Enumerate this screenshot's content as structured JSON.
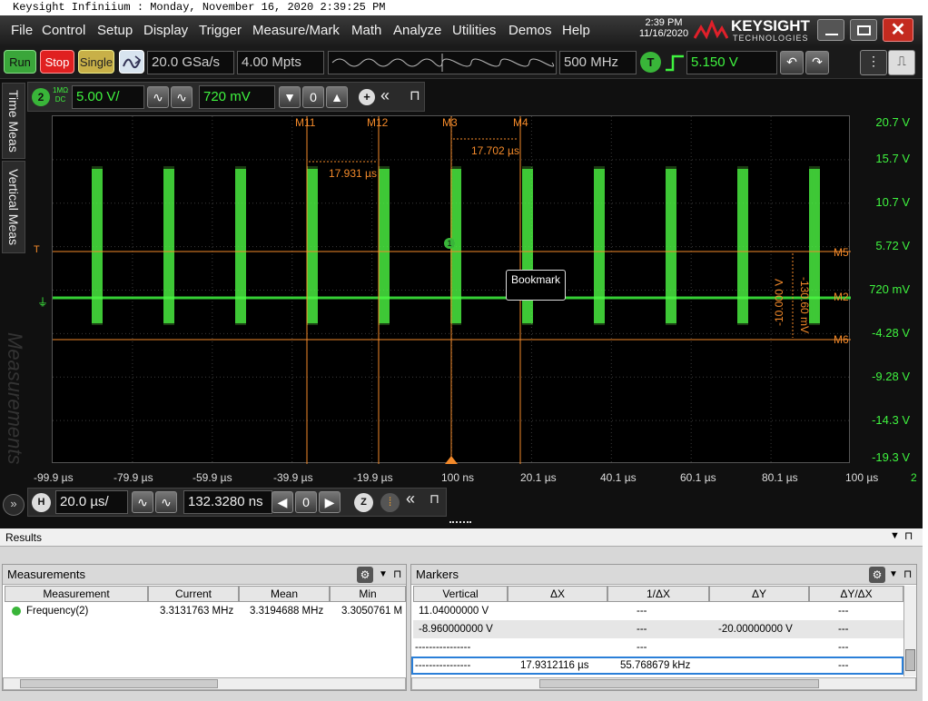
{
  "window_title": "Keysight Infiniium : Monday, November 16, 2020 2:39:25 PM",
  "clock": {
    "time": "2:39 PM",
    "date": "11/16/2020"
  },
  "brand": {
    "name": "KEYSIGHT",
    "sub": "TECHNOLOGIES"
  },
  "menu": [
    "File",
    "Control",
    "Setup",
    "Display",
    "Trigger",
    "Measure/Mark",
    "Math",
    "Analyze",
    "Utilities",
    "Demos",
    "Help"
  ],
  "toolbar": {
    "run": "Run",
    "stop": "Stop",
    "single": "Single",
    "sample_rate": "20.0 GSa/s",
    "memory": "4.00 Mpts",
    "bandwidth": "500 MHz",
    "trigger_icon": "T",
    "trigger_level": "5.150 V"
  },
  "channel": {
    "number": "2",
    "impedance": "1MΩ",
    "coupling": "DC",
    "scale": "5.00 V/",
    "offset": "720 mV"
  },
  "side_tabs": [
    "Time Meas",
    "Vertical Meas",
    "Measurements"
  ],
  "grid": {
    "y_labels": [
      "20.7 V",
      "15.7 V",
      "10.7 V",
      "5.72 V",
      "720 mV",
      "-4.28 V",
      "-9.28 V",
      "-14.3 V",
      "-19.3 V"
    ],
    "x_labels": [
      "-99.9 µs",
      "-79.9 µs",
      "-59.9 µs",
      "-39.9 µs",
      "-19.9 µs",
      "100 ns",
      "20.1 µs",
      "40.1 µs",
      "60.1 µs",
      "80.1 µs",
      "100 µs"
    ],
    "channel_tag": "2",
    "markers_v": [
      "M11",
      "M12",
      "M3",
      "M4"
    ],
    "markers_h": [
      "M5",
      "M2",
      "M6"
    ],
    "delta_m11_m12": "17.931 µs",
    "delta_m3_m4": "17.702 µs",
    "delta_v_m5_m6": "-10.000 V",
    "delta_v_m2": "-130.60 mV",
    "bookmark": "Bookmark",
    "trigger_tag": "T",
    "marker_point": "1"
  },
  "horizontal": {
    "badge": "H",
    "scale": "20.0 µs/",
    "position": "132.3280 ns",
    "zoom": "Z"
  },
  "results": {
    "title": "Results",
    "measurements": {
      "title": "Measurements",
      "columns": [
        "Measurement",
        "Current",
        "Mean",
        "Min"
      ],
      "row": {
        "name": "Frequency(2)",
        "current": "3.3131763 MHz",
        "mean": "3.3194688 MHz",
        "min": "3.3050761 M"
      }
    },
    "markers": {
      "title": "Markers",
      "columns": [
        "Vertical",
        "ΔX",
        "1/ΔX",
        "ΔY",
        "ΔY/ΔX"
      ],
      "rows": [
        {
          "vertical": "11.04000000 V",
          "dx": "",
          "inv": "---",
          "dy": "",
          "dydx": "---"
        },
        {
          "vertical": "-8.960000000 V",
          "dx": "",
          "inv": "---",
          "dy": "-20.00000000 V",
          "dydx": "---"
        },
        {
          "vertical": "----------------",
          "dx": "",
          "inv": "---",
          "dy": "",
          "dydx": "---"
        },
        {
          "vertical": "----------------",
          "dx": "17.9312116 µs",
          "inv": "55.768679 kHz",
          "dy": "",
          "dydx": "---"
        }
      ]
    }
  },
  "colors": {
    "trace": "#3ff33f",
    "marker": "#f48a2a",
    "run": "#3aa63a",
    "stop": "#e02020",
    "single": "#c8b048"
  }
}
